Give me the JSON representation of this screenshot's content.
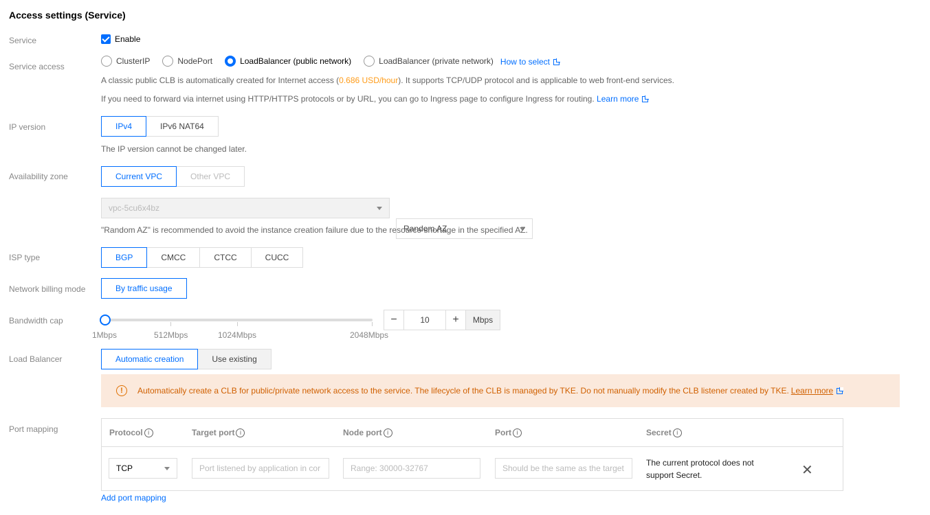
{
  "title": "Access settings (Service)",
  "service": {
    "label": "Service",
    "checkbox_label": "Enable"
  },
  "service_access": {
    "label": "Service access",
    "options": [
      "ClusterIP",
      "NodePort",
      "LoadBalancer (public network)",
      "LoadBalancer (private network)"
    ],
    "selected": "LoadBalancer (public network)",
    "how_to_select": "How to select",
    "desc1_pre": "A classic public CLB is automatically created for Internet access (",
    "desc1_price": "0.686 USD/hour",
    "desc1_post": "). It supports TCP/UDP protocol and is applicable to web front-end services.",
    "desc2": "If you need to forward via internet using HTTP/HTTPS protocols or by URL, you can go to Ingress page to configure Ingress for routing.",
    "learn_more": "Learn more"
  },
  "ip_version": {
    "label": "IP version",
    "options": [
      "IPv4",
      "IPv6 NAT64"
    ],
    "selected": "IPv4",
    "hint": "The IP version cannot be changed later."
  },
  "availability_zone": {
    "label": "Availability zone",
    "options": [
      "Current VPC",
      "Other VPC"
    ],
    "selected": "Current VPC",
    "vpc_value": "vpc-5cu6x4bz",
    "az_value": "Random AZ",
    "hint": "\"Random AZ\" is recommended to avoid the instance creation failure due to the resource shortage in the specified AZ."
  },
  "isp_type": {
    "label": "ISP type",
    "options": [
      "BGP",
      "CMCC",
      "CTCC",
      "CUCC"
    ],
    "selected": "BGP"
  },
  "billing": {
    "label": "Network billing mode",
    "option": "By traffic usage"
  },
  "bandwidth": {
    "label": "Bandwidth cap",
    "ticks": [
      "1Mbps",
      "512Mbps",
      "1024Mbps",
      "2048Mbps"
    ],
    "value": "10",
    "unit": "Mbps",
    "minus": "−",
    "plus": "+"
  },
  "load_balancer": {
    "label": "Load Balancer",
    "options": [
      "Automatic creation",
      "Use existing"
    ],
    "selected": "Automatic creation",
    "warning": "Automatically create a CLB for public/private network access to the service. The lifecycle of the CLB is managed by TKE. Do not manually modify the CLB listener created by TKE.",
    "warning_link": "Learn more",
    "warning_icon": "!"
  },
  "port_mapping": {
    "label": "Port mapping",
    "headers": [
      "Protocol",
      "Target port",
      "Node port",
      "Port",
      "Secret"
    ],
    "info_icon": "i",
    "protocol_value": "TCP",
    "target_placeholder": "Port listened by application in cor",
    "node_placeholder": "Range: 30000-32767",
    "port_placeholder": "Should be the same as the target",
    "secret_text_1": "The current protocol does not",
    "secret_text_2": "support Secret.",
    "add_link": "Add port mapping",
    "close_glyph": "✕"
  }
}
